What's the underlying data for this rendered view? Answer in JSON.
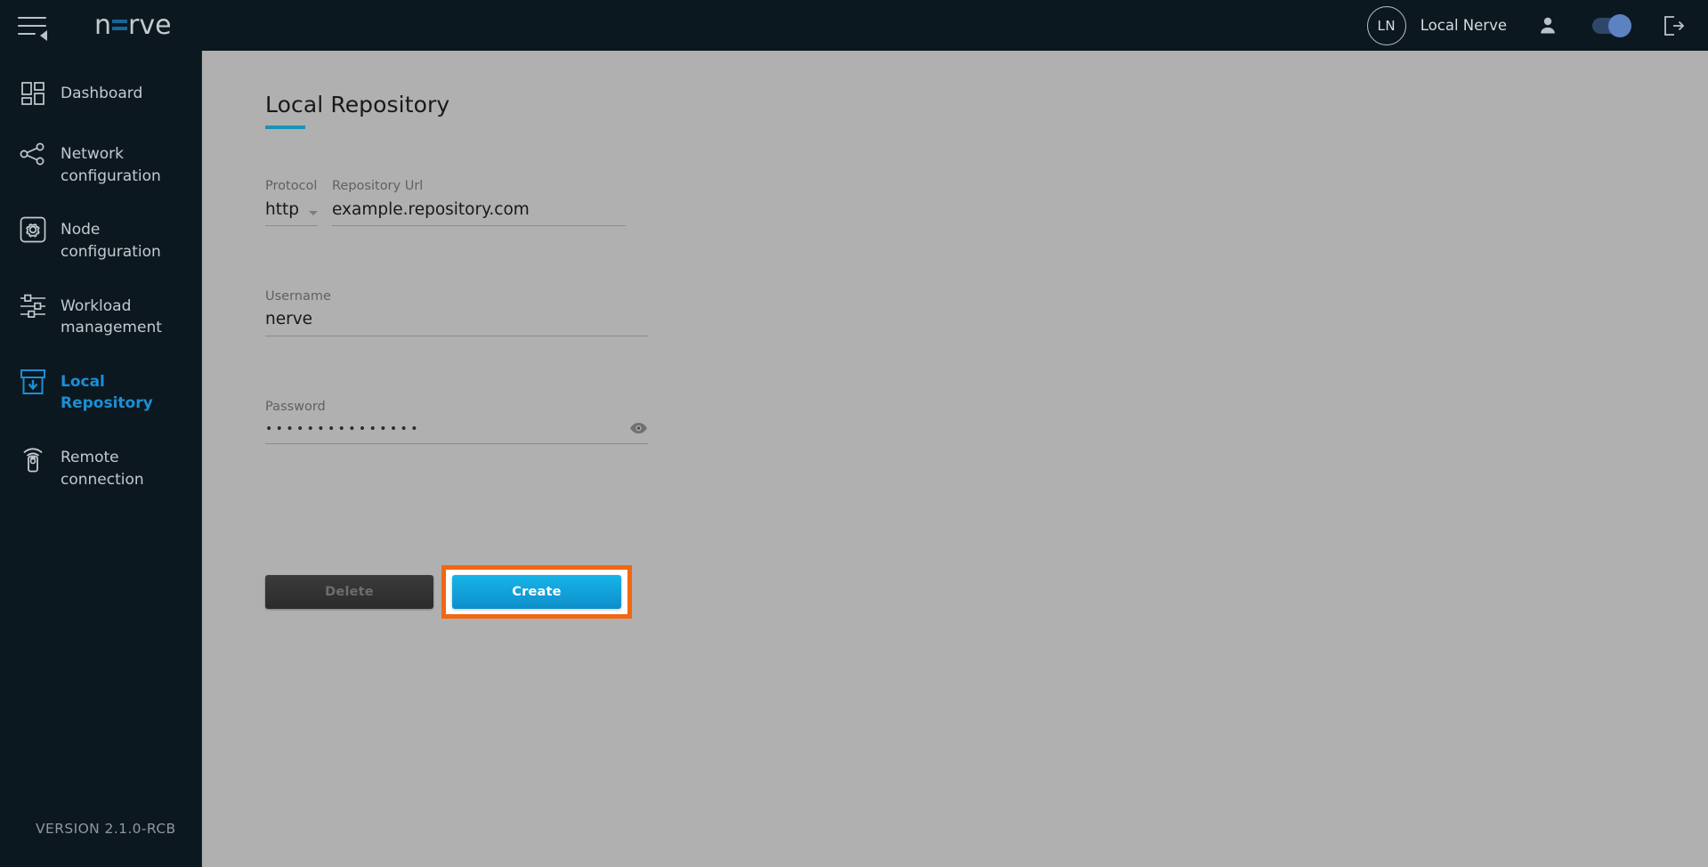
{
  "topbar": {
    "menu_icon": "hamburger-collapse-icon",
    "logo_text_left": "n",
    "logo_text_right": "rve",
    "avatar_initials": "LN",
    "user_name": "Local Nerve",
    "person_icon": "person-icon",
    "toggle_state": "on",
    "logout_icon": "logout-icon"
  },
  "sidebar": {
    "items": [
      {
        "label": "Dashboard",
        "icon": "dashboard-grid-icon",
        "active": false
      },
      {
        "label": "Network configuration",
        "icon": "network-share-icon",
        "active": false
      },
      {
        "label": "Node configuration",
        "icon": "gear-square-icon",
        "active": false
      },
      {
        "label": "Workload management",
        "icon": "sliders-icon",
        "active": false
      },
      {
        "label": "Local Repository",
        "icon": "archive-download-icon",
        "active": true
      },
      {
        "label": "Remote connection",
        "icon": "remote-control-icon",
        "active": false
      }
    ],
    "version": "VERSION 2.1.0-RCB"
  },
  "main": {
    "page_title": "Local Repository",
    "form": {
      "protocol": {
        "label": "Protocol",
        "value": "http",
        "caret_icon": "chevron-down-icon"
      },
      "repository_url": {
        "label": "Repository Url",
        "value": "example.repository.com",
        "placeholder": "example.repository.com"
      },
      "username": {
        "label": "Username",
        "value": "nerve",
        "placeholder": "Username"
      },
      "password": {
        "label": "Password",
        "value": "•••••••••••••••",
        "placeholder": "Password",
        "reveal_icon": "eye-icon"
      }
    },
    "buttons": {
      "delete_label": "Delete",
      "create_label": "Create"
    }
  },
  "colors": {
    "brand_blue": "#1b8fd6",
    "accent_teal": "#1795b5",
    "sidebar_bg": "#0c1820",
    "main_bg": "#b0b0b0",
    "highlight_orange": "#f26711",
    "create_button_top": "#16b5e8",
    "create_button_bottom": "#0e8ecb"
  }
}
